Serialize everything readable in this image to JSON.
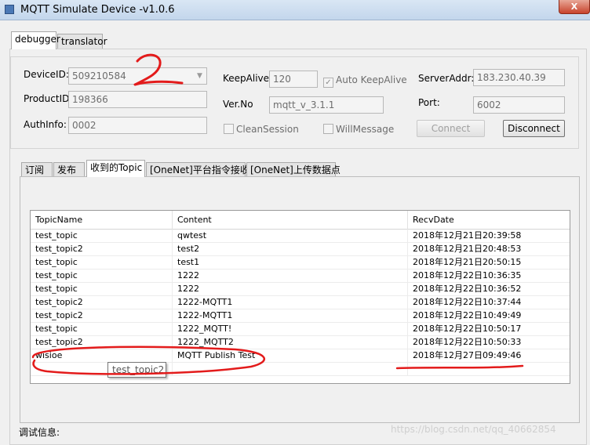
{
  "window": {
    "title": "MQTT Simulate Device  -v1.0.6",
    "close_glyph": "X"
  },
  "main_tabs": [
    {
      "label": "debugger"
    },
    {
      "label": "translator"
    }
  ],
  "connection": {
    "device_id_label": "DeviceID:",
    "device_id_value": "509210584",
    "product_id_label": "ProductID:",
    "product_id_value": "198366",
    "auth_info_label": "AuthInfo:",
    "auth_info_value": "0002",
    "keepalive_label": "KeepAlive:",
    "keepalive_value": "120",
    "auto_keepalive_label": "Auto KeepAlive",
    "auto_keepalive_checked": true,
    "verno_label": "Ver.No",
    "verno_value": "mqtt_v_3.1.1",
    "clean_session_label": "CleanSession",
    "will_message_label": "WillMessage",
    "server_addr_label": "ServerAddr:",
    "server_addr_value": "183.230.40.39",
    "port_label": "Port:",
    "port_value": "6002",
    "connect_label": "Connect",
    "disconnect_label": "Disconnect"
  },
  "sub_tabs": [
    {
      "label": "订阅"
    },
    {
      "label": "发布"
    },
    {
      "label": "收到的Topic"
    },
    {
      "label": "[OneNet]平台指令接收"
    },
    {
      "label": "[OneNet]上传数据点"
    }
  ],
  "table": {
    "columns": [
      "TopicName",
      "Content",
      "RecvDate"
    ],
    "rows": [
      {
        "topic": "test_topic",
        "content": "qwtest",
        "date": "2018年12月21日20:39:58"
      },
      {
        "topic": "test_topic2",
        "content": "test2",
        "date": "2018年12月21日20:48:53"
      },
      {
        "topic": "test_topic",
        "content": "test1",
        "date": "2018年12月21日20:50:15"
      },
      {
        "topic": "test_topic",
        "content": "1222",
        "date": "2018年12月22日10:36:35"
      },
      {
        "topic": "test_topic",
        "content": "1222",
        "date": "2018年12月22日10:36:52"
      },
      {
        "topic": "test_topic2",
        "content": "1222-MQTT1",
        "date": "2018年12月22日10:37:44"
      },
      {
        "topic": "test_topic2",
        "content": "1222-MQTT1",
        "date": "2018年12月22日10:49:49"
      },
      {
        "topic": "test_topic",
        "content": "1222_MQTT!",
        "date": "2018年12月22日10:50:17"
      },
      {
        "topic": "test_topic2",
        "content": "1222_MQTT2",
        "date": "2018年12月22日10:50:33"
      },
      {
        "topic": "wisioe",
        "content": "MQTT Publish Test",
        "date": "2018年12月27日09:49:46"
      },
      {
        "topic": "",
        "content": "",
        "date": ""
      }
    ]
  },
  "tooltip": {
    "text": "test_topic2"
  },
  "debug": {
    "label": "调试信息:"
  },
  "watermark": {
    "text": "https://blog.csdn.net/qq_40662854"
  },
  "annotation": {
    "color": "#e31b1b",
    "glyph": "2"
  }
}
